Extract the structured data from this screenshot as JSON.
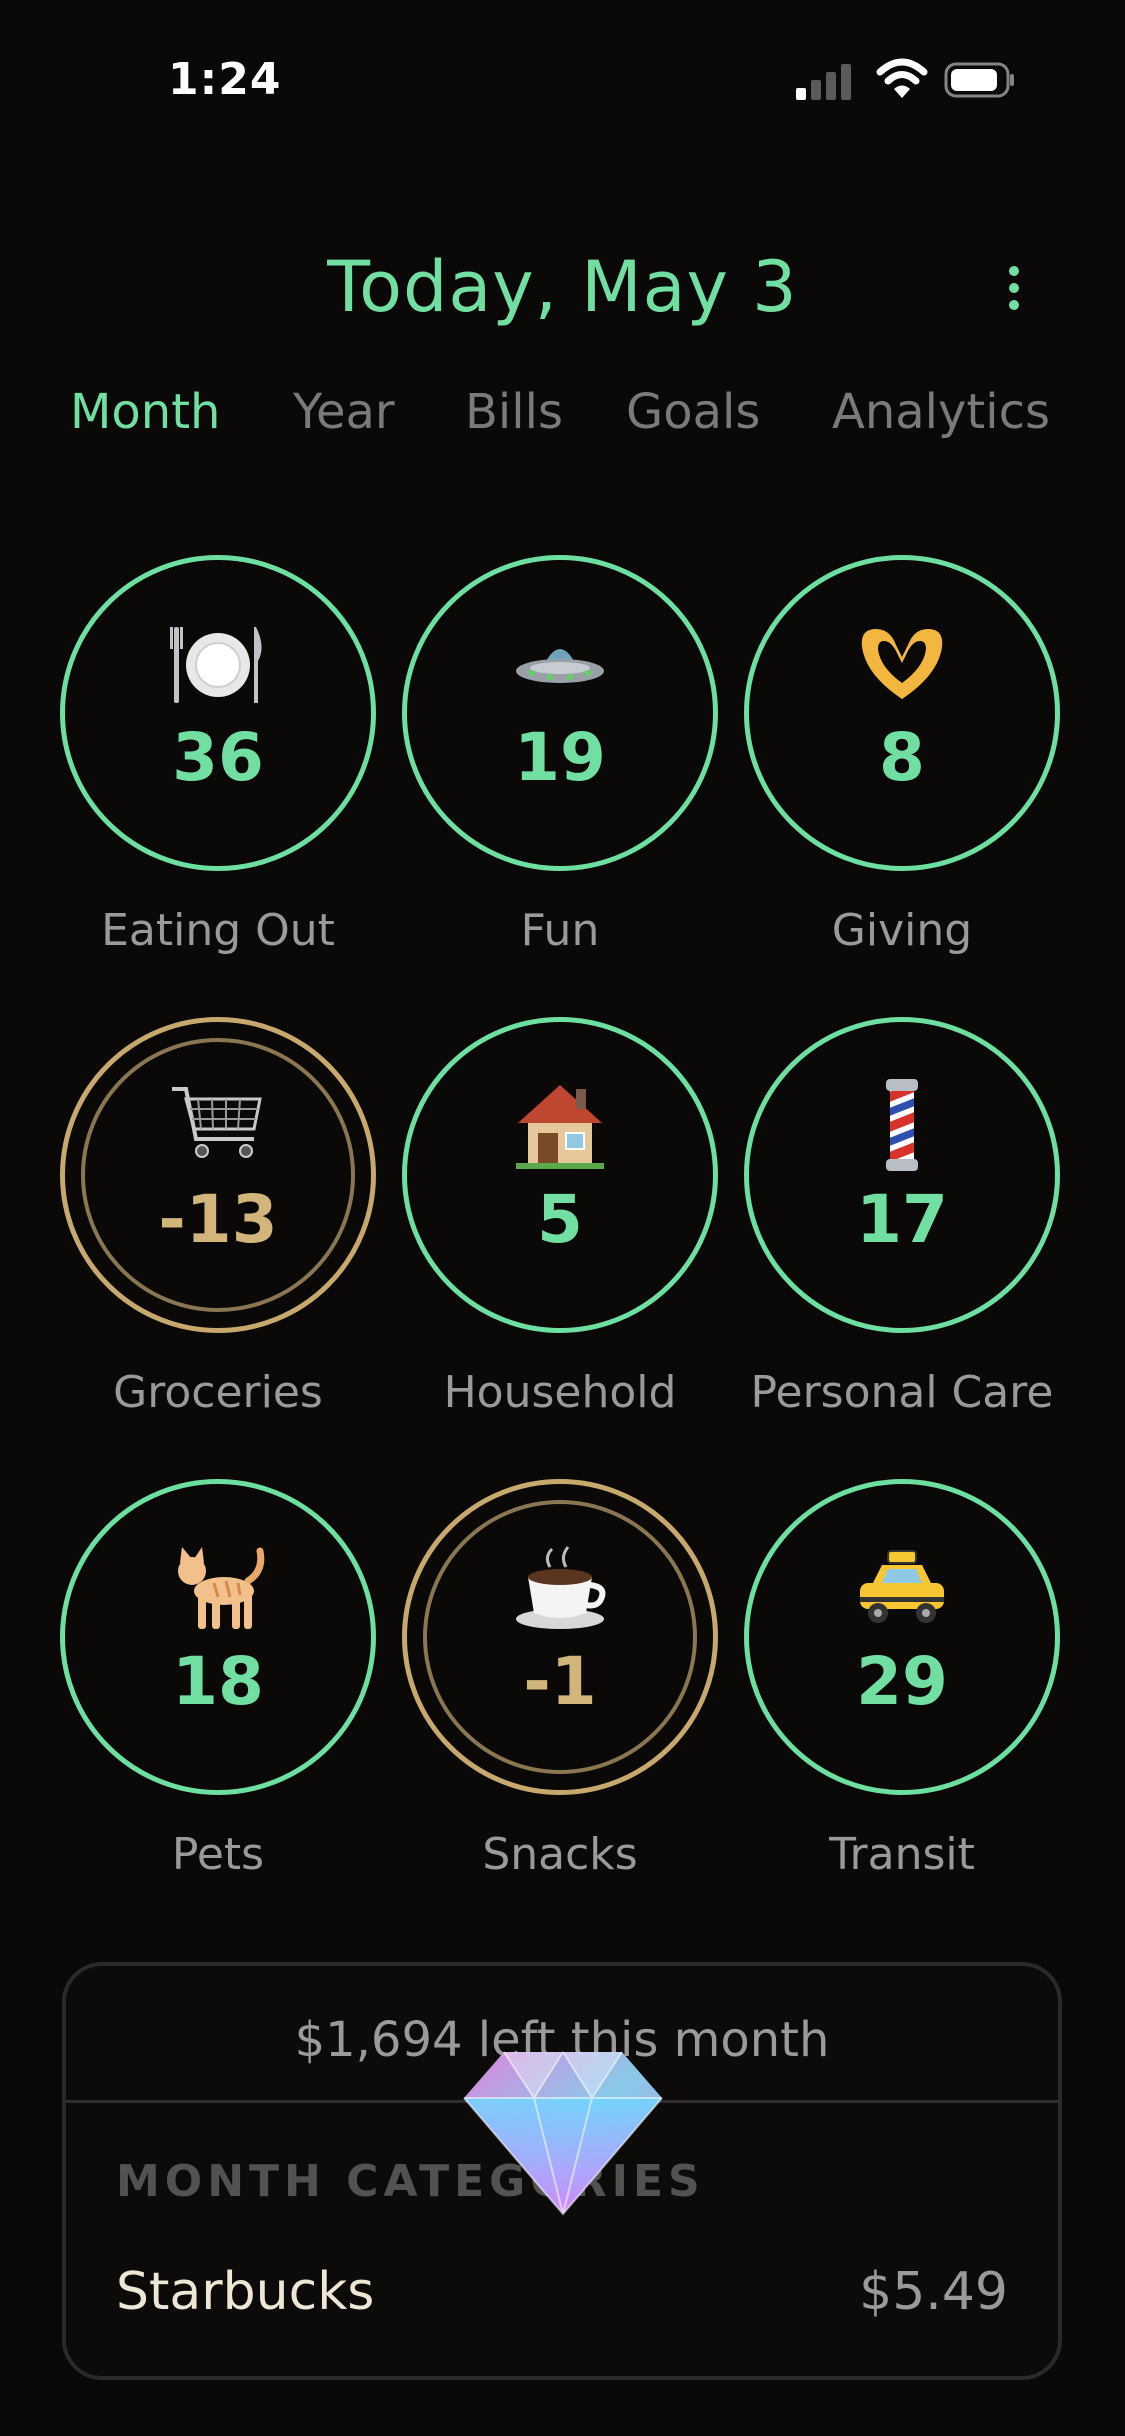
{
  "status_bar": {
    "time": "1:24",
    "signal_bars": 1,
    "battery_level": 0.85
  },
  "header": {
    "title": "Today, May 3",
    "more_icon": "more-vertical-icon"
  },
  "tabs": [
    {
      "label": "Month",
      "active": true
    },
    {
      "label": "Year",
      "active": false
    },
    {
      "label": "Bills",
      "active": false
    },
    {
      "label": "Goals",
      "active": false
    },
    {
      "label": "Analytics",
      "active": false
    }
  ],
  "categories": [
    {
      "name": "Eating Out",
      "value": "36",
      "icon": "plate-cutlery-icon",
      "over_budget": false
    },
    {
      "name": "Fun",
      "value": "19",
      "icon": "ufo-icon",
      "over_budget": false
    },
    {
      "name": "Giving",
      "value": "8",
      "icon": "heart-hands-icon",
      "over_budget": false
    },
    {
      "name": "Groceries",
      "value": "-13",
      "icon": "shopping-cart-icon",
      "over_budget": true
    },
    {
      "name": "Household",
      "value": "5",
      "icon": "house-icon",
      "over_budget": false
    },
    {
      "name": "Personal Care",
      "value": "17",
      "icon": "barber-pole-icon",
      "over_budget": false
    },
    {
      "name": "Pets",
      "value": "18",
      "icon": "cat-icon",
      "over_budget": false
    },
    {
      "name": "Snacks",
      "value": "-1",
      "icon": "coffee-cup-icon",
      "over_budget": true
    },
    {
      "name": "Transit",
      "value": "29",
      "icon": "taxi-icon",
      "over_budget": false
    }
  ],
  "summary": {
    "left_text": "$1,694 left this month",
    "section_title": "MONTH CATEGORIES",
    "rows": [
      {
        "name": "Starbucks",
        "amount": "$5.49"
      }
    ]
  },
  "colors": {
    "accent": "#72dfa2",
    "over_budget": "#c8a96d",
    "background": "#0a0908"
  }
}
